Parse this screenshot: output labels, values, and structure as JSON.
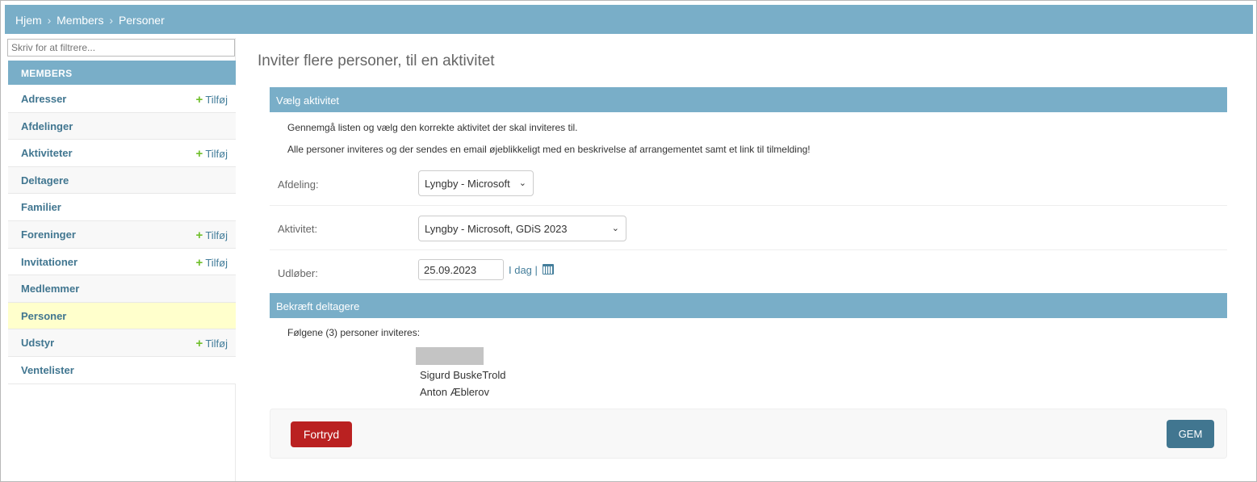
{
  "breadcrumb": {
    "home": "Hjem",
    "members": "Members",
    "current": "Personer",
    "separator": "›"
  },
  "sidebar": {
    "filter_placeholder": "Skriv for at filtrere...",
    "section_title": "MEMBERS",
    "add_label": "Tilføj",
    "items": [
      {
        "label": "Adresser",
        "add": true
      },
      {
        "label": "Afdelinger",
        "add": false
      },
      {
        "label": "Aktiviteter",
        "add": true
      },
      {
        "label": "Deltagere",
        "add": false
      },
      {
        "label": "Familier",
        "add": false
      },
      {
        "label": "Foreninger",
        "add": true
      },
      {
        "label": "Invitationer",
        "add": true
      },
      {
        "label": "Medlemmer",
        "add": false
      },
      {
        "label": "Personer",
        "add": false,
        "active": true
      },
      {
        "label": "Udstyr",
        "add": true
      },
      {
        "label": "Ventelister",
        "add": false
      }
    ]
  },
  "main": {
    "title": "Inviter flere personer, til en aktivitet",
    "section1": {
      "title": "Vælg aktivitet",
      "desc1": "Gennemgå listen og vælg den korrekte aktivitet der skal inviteres til.",
      "desc2": "Alle personer inviteres og der sendes en email øjeblikkeligt med en beskrivelse af arrangementet samt et link til tilmelding!"
    },
    "form": {
      "afdeling_label": "Afdeling:",
      "afdeling_value": "Lyngby - Microsoft",
      "aktivitet_label": "Aktivitet:",
      "aktivitet_value": "Lyngby - Microsoft, GDiS 2023",
      "udlober_label": "Udløber:",
      "udlober_value": "25.09.2023",
      "today_link": "I dag",
      "link_sep": "|"
    },
    "section2": {
      "title": "Bekræft deltagere",
      "count_text": "Følgene (3) personer inviteres:",
      "persons": [
        "Sigurd BuskeTrold",
        "Anton Æblerov"
      ]
    },
    "buttons": {
      "cancel": "Fortryd",
      "save": "GEM"
    }
  },
  "colors": {
    "header": "#79aec8",
    "cancel": "#ba2121",
    "save": "#417690",
    "active_row": "#ffffcc",
    "add_plus": "#70bf2b"
  }
}
